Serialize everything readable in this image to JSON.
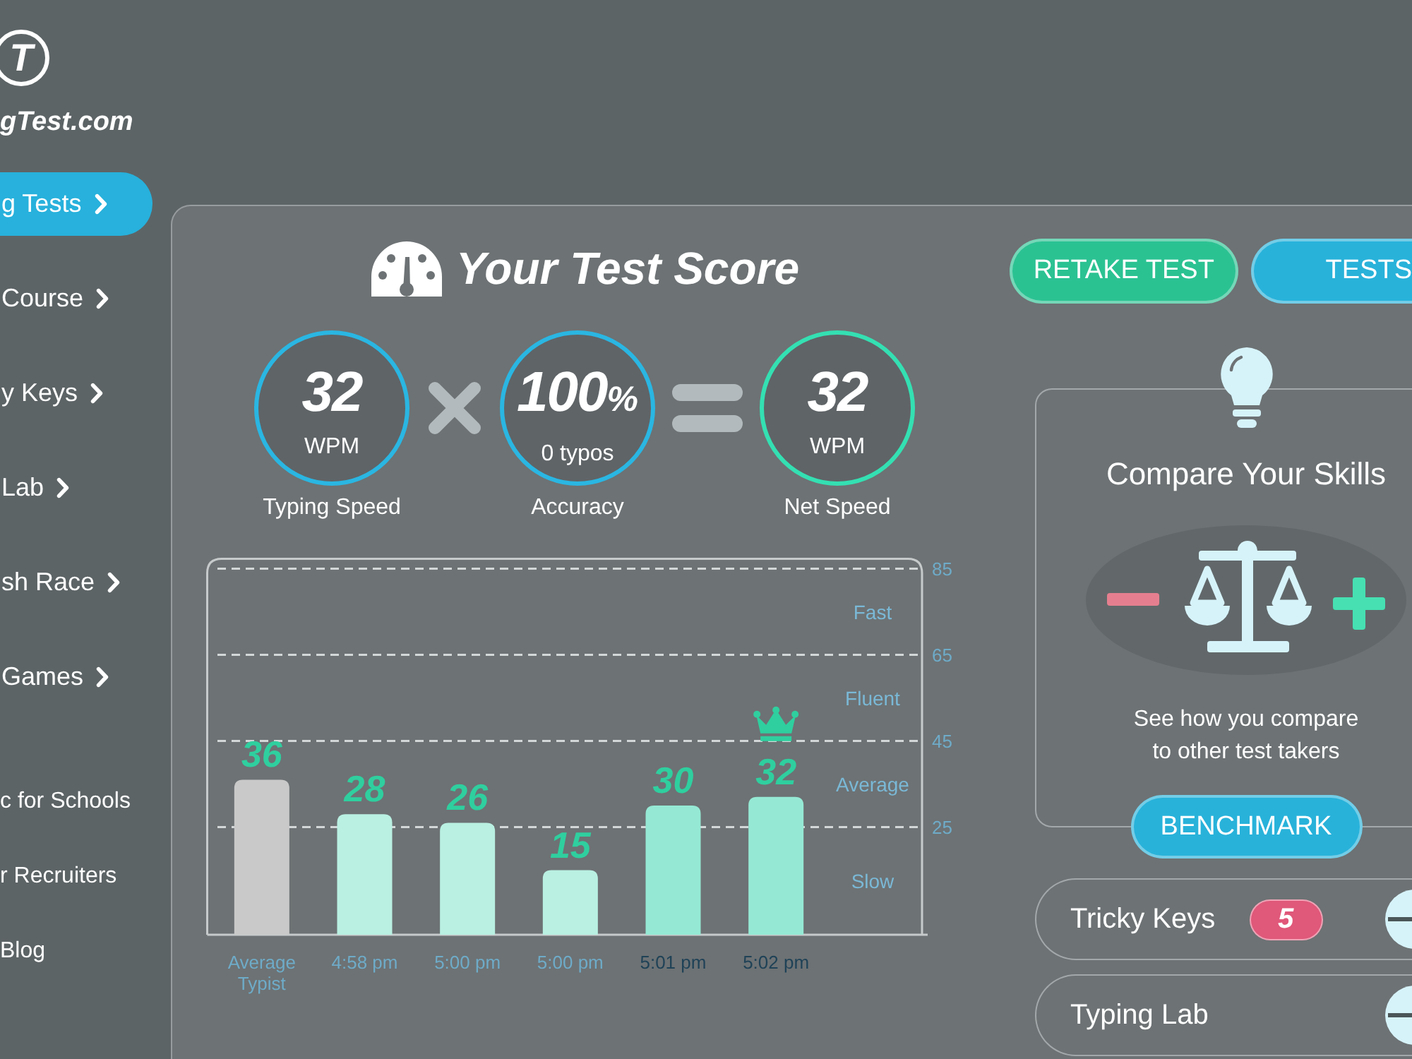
{
  "logo": {
    "mark": "T",
    "text": "gTest.com"
  },
  "sidebar": {
    "items": [
      {
        "label": "g Tests",
        "selected": true
      },
      {
        "label": "Course",
        "selected": false
      },
      {
        "label": "y Keys",
        "selected": false
      },
      {
        "label": "Lab",
        "selected": false
      },
      {
        "label": "sh Race",
        "selected": false
      },
      {
        "label": "Games",
        "selected": false
      }
    ],
    "links": [
      "c for Schools",
      "r Recruiters",
      "Blog"
    ]
  },
  "score": {
    "title": "Your Test Score",
    "metrics": [
      {
        "value": "32",
        "unit": "WPM",
        "label": "Typing Speed",
        "color": "#2ab6e2"
      },
      {
        "value": "100",
        "suffix": "%",
        "unit": "0 typos",
        "label": "Accuracy",
        "color": "#2ab6e2"
      },
      {
        "value": "32",
        "unit": "WPM",
        "label": "Net Speed",
        "color": "#34e0b2"
      }
    ],
    "chart": {
      "chart_data": {
        "type": "bar",
        "categories": [
          "Average Typist",
          "4:58 pm",
          "5:00 pm",
          "5:00 pm",
          "5:01 pm",
          "5:02 pm"
        ],
        "values": [
          36,
          28,
          26,
          15,
          30,
          32
        ],
        "ylim": [
          0,
          85
        ],
        "yticks": [
          25,
          45,
          65,
          85
        ],
        "grid": true,
        "data_labels": true
      },
      "zones": [
        "Fast",
        "Fluent",
        "Average",
        "Slow"
      ],
      "bars": [
        {
          "color": "#c9c9c9",
          "crowned": false
        },
        {
          "color": "#b9f0e1",
          "crowned": false
        },
        {
          "color": "#b9f0e1",
          "crowned": false
        },
        {
          "color": "#b9f0e1",
          "crowned": false
        },
        {
          "color": "#95e9d4",
          "crowned": false
        },
        {
          "color": "#95e9d4",
          "crowned": true
        }
      ],
      "x_labels": [
        {
          "color": "#6eabc8"
        },
        {
          "color": "#6eabc8"
        },
        {
          "color": "#6eabc8"
        },
        {
          "color": "#6eabc8"
        },
        {
          "color": "#1f4257"
        },
        {
          "color": "#1f4257"
        }
      ]
    }
  },
  "actions": [
    {
      "label": "RETAKE TEST",
      "color": "#2bc292"
    },
    {
      "label": "TESTS",
      "color": "#28b2da"
    }
  ],
  "compare": {
    "title": "Compare Your Skills",
    "text": "See how you compare to other test takers",
    "button": "BENCHMARK"
  },
  "shortcuts": [
    {
      "label": "Tricky Keys",
      "badge": "5"
    },
    {
      "label": "Typing Lab"
    }
  ]
}
